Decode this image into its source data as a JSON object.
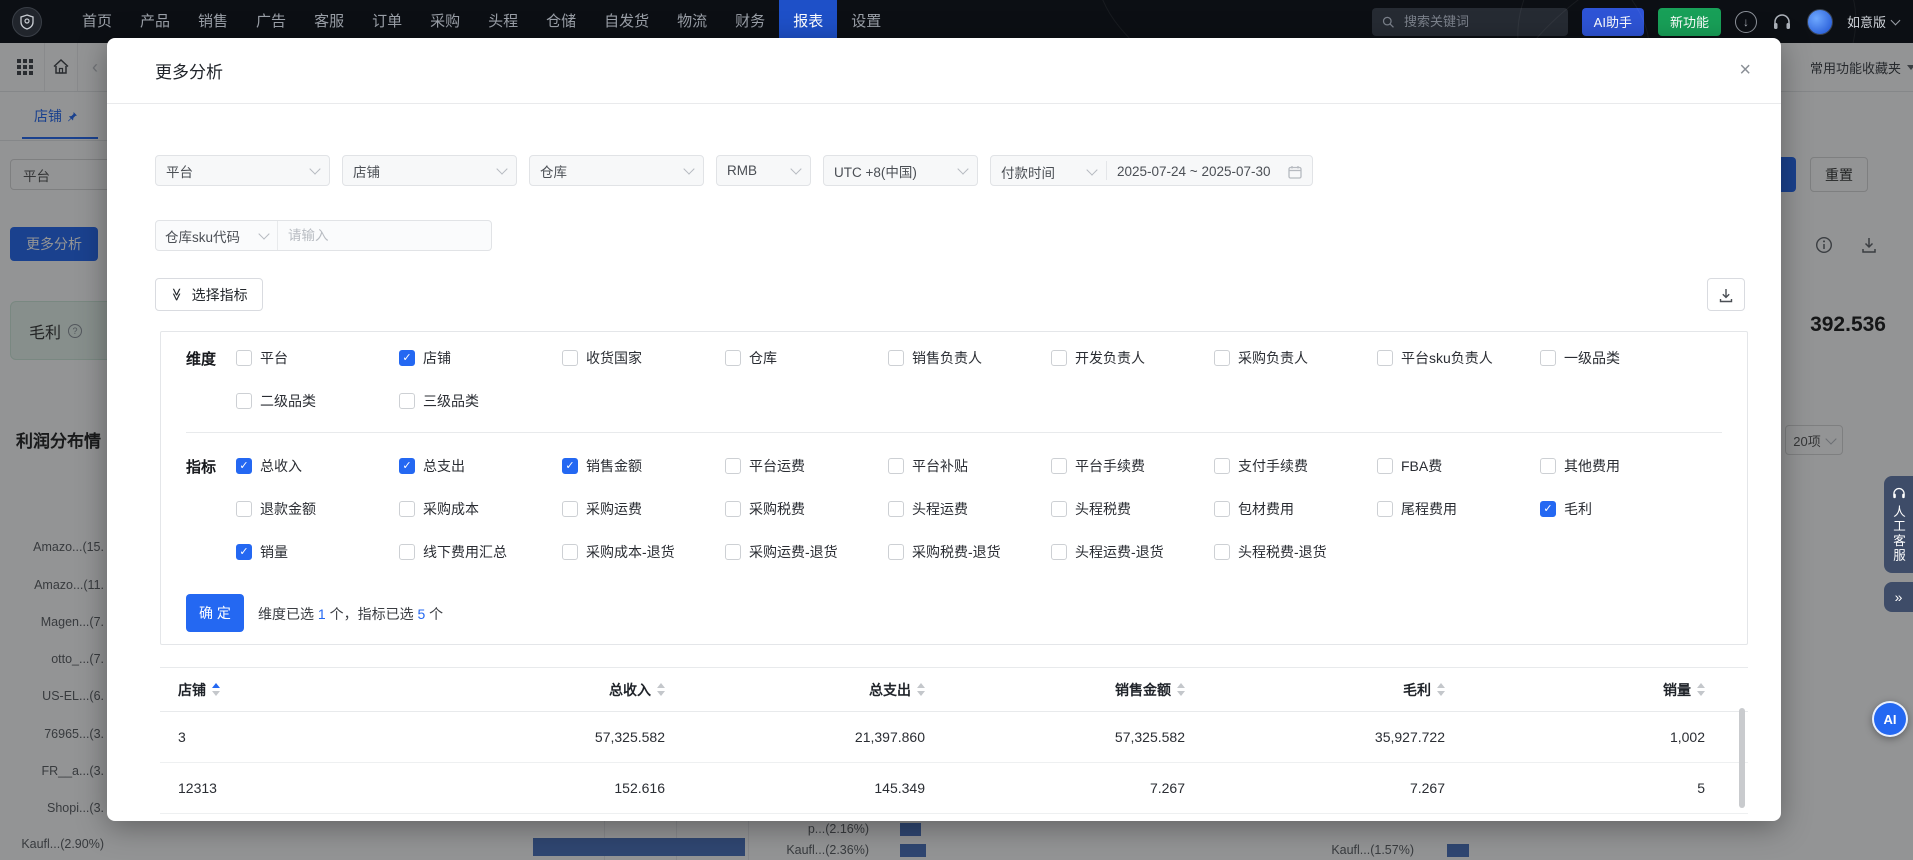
{
  "topnav": {
    "items": [
      {
        "label": "首页",
        "active": false
      },
      {
        "label": "产品",
        "active": false
      },
      {
        "label": "销售",
        "active": false
      },
      {
        "label": "广告",
        "active": false
      },
      {
        "label": "客服",
        "active": false
      },
      {
        "label": "订单",
        "active": false
      },
      {
        "label": "采购",
        "active": false
      },
      {
        "label": "头程",
        "active": false
      },
      {
        "label": "仓储",
        "active": false
      },
      {
        "label": "自发货",
        "active": false
      },
      {
        "label": "物流",
        "active": false
      },
      {
        "label": "财务",
        "active": false
      },
      {
        "label": "报表",
        "active": true
      },
      {
        "label": "设置",
        "active": false
      }
    ],
    "search_placeholder": "搜索关键词",
    "ai_assistant": "AI助手",
    "new_feature": "新功能",
    "download_glyph": "↓",
    "edition": "如意版"
  },
  "secondary": {
    "favorites": "常用功能收藏夹"
  },
  "page": {
    "store_tab": "店铺",
    "platform_select": "平台",
    "more_analysis_button": "更多分析",
    "gross_profit_card": "毛利",
    "question_glyph": "?",
    "profit_heading": "利润分布情",
    "left_chart_labels": [
      "Amazo...(15.",
      "Amazo...(11.",
      "Magen...(7.",
      "otto_...(7.",
      "US-EL...(6.",
      "76965...(3.",
      "FR__a...(3.",
      "Shopi...(3.",
      "Kaufl...(2.90%)"
    ],
    "mid_chart_labels": [
      "p...(2.16%)",
      "Kaufl...(2.36%)"
    ],
    "right_chart_label": "Kaufl...(1.57%)",
    "reset_button": "重置",
    "total_value": "392.536",
    "page_size": "20项",
    "service_tab": "人工客服",
    "collapse_glyph": "»",
    "ai_fab": "AI",
    "accent_blue": "#2468f2",
    "bar_blue": "#4a72bd"
  },
  "modal": {
    "title": "更多分析",
    "close": "×",
    "filters": {
      "platform": "平台",
      "shop": "店铺",
      "warehouse": "仓库",
      "currency": "RMB",
      "timezone": "UTC +8(中国)",
      "time_type": "付款时间",
      "date_range": "2025-07-24 ~ 2025-07-30"
    },
    "sku": {
      "field": "仓库sku代码",
      "placeholder": "请输入"
    },
    "select_metrics": "选择指标",
    "dblchev_glyph": "≫",
    "dimensions": {
      "label": "维度",
      "rows": [
        [
          {
            "label": "平台",
            "checked": false
          },
          {
            "label": "店铺",
            "checked": true
          },
          {
            "label": "收货国家",
            "checked": false
          },
          {
            "label": "仓库",
            "checked": false
          },
          {
            "label": "销售负责人",
            "checked": false
          },
          {
            "label": "开发负责人",
            "checked": false
          },
          {
            "label": "采购负责人",
            "checked": false
          },
          {
            "label": "平台sku负责人",
            "checked": false
          },
          {
            "label": "一级品类",
            "checked": false
          }
        ],
        [
          {
            "label": "二级品类",
            "checked": false
          },
          {
            "label": "三级品类",
            "checked": false
          }
        ]
      ]
    },
    "metrics": {
      "label": "指标",
      "rows": [
        [
          {
            "label": "总收入",
            "checked": true
          },
          {
            "label": "总支出",
            "checked": true
          },
          {
            "label": "销售金额",
            "checked": true
          },
          {
            "label": "平台运费",
            "checked": false
          },
          {
            "label": "平台补贴",
            "checked": false
          },
          {
            "label": "平台手续费",
            "checked": false
          },
          {
            "label": "支付手续费",
            "checked": false
          },
          {
            "label": "FBA费",
            "checked": false
          },
          {
            "label": "其他费用",
            "checked": false
          }
        ],
        [
          {
            "label": "退款金额",
            "checked": false
          },
          {
            "label": "采购成本",
            "checked": false
          },
          {
            "label": "采购运费",
            "checked": false
          },
          {
            "label": "采购税费",
            "checked": false
          },
          {
            "label": "头程运费",
            "checked": false
          },
          {
            "label": "头程税费",
            "checked": false
          },
          {
            "label": "包材费用",
            "checked": false
          },
          {
            "label": "尾程费用",
            "checked": false
          },
          {
            "label": "毛利",
            "checked": true
          }
        ],
        [
          {
            "label": "销量",
            "checked": true
          },
          {
            "label": "线下费用汇总",
            "checked": false
          },
          {
            "label": "采购成本-退货",
            "checked": false
          },
          {
            "label": "采购运费-退货",
            "checked": false
          },
          {
            "label": "采购税费-退货",
            "checked": false
          },
          {
            "label": "头程运费-退货",
            "checked": false
          },
          {
            "label": "头程税费-退货",
            "checked": false
          }
        ]
      ]
    },
    "confirm": "确 定",
    "summary": {
      "t1": "维度已选 ",
      "n1": "1",
      "t2": " 个，指标已选 ",
      "n2": "5",
      "t3": " 个"
    },
    "table": {
      "headers": [
        {
          "label": "店铺",
          "sorted": true
        },
        {
          "label": "总收入",
          "sorted": false
        },
        {
          "label": "总支出",
          "sorted": false
        },
        {
          "label": "销售金额",
          "sorted": false
        },
        {
          "label": "毛利",
          "sorted": false
        },
        {
          "label": "销量",
          "sorted": false
        }
      ],
      "rows": [
        [
          "3",
          "57,325.582",
          "21,397.860",
          "57,325.582",
          "35,927.722",
          "1,002"
        ],
        [
          "12313",
          "152.616",
          "145.349",
          "7.267",
          "7.267",
          "5"
        ]
      ]
    }
  }
}
